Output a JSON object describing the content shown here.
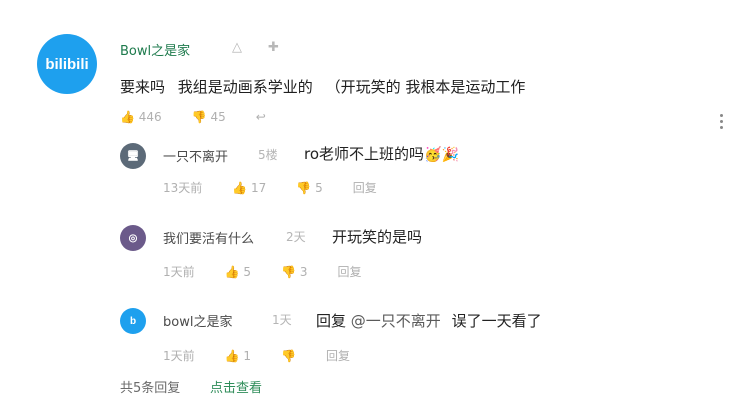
{
  "main_comment": {
    "avatar_text": "bilibili",
    "username": "Bowl之是家",
    "text_part1": "要来吗",
    "text_part2": "我组是动画系学业的",
    "text_part3": "（开玩笑的 我根本是运动工作",
    "likes": "446",
    "dislike": "45",
    "reply": "",
    "share": ""
  },
  "replies": [
    {
      "username": "一只不离开",
      "tag": "5楼",
      "text": "ro老师不上班的吗",
      "emoji": "🥳🎉",
      "likes": "13天前",
      "dislike": "17",
      "reply_label": "5",
      "share_label": "回复"
    },
    {
      "username": "我们要活有什么",
      "tag": "2天",
      "text": "开玩笑的是吗",
      "likes": "1天前",
      "dislike": "5",
      "reply_label": "3",
      "share_label": "回复"
    },
    {
      "username": "bowl之是家",
      "tag": "1天",
      "text_prefix": "回复",
      "mention": "@一只不离开",
      "text_suffix": "误了一天看了",
      "likes": "1天前",
      "dislike": "1",
      "reply_label": "",
      "share_label": "回复"
    }
  ],
  "footer": {
    "left": "共5条回复",
    "right": "点击查看"
  },
  "colors": {
    "avatar_blue": "#1ea0ee",
    "username_green": "#1d7a4c",
    "footer_green": "#2f8d5a"
  }
}
